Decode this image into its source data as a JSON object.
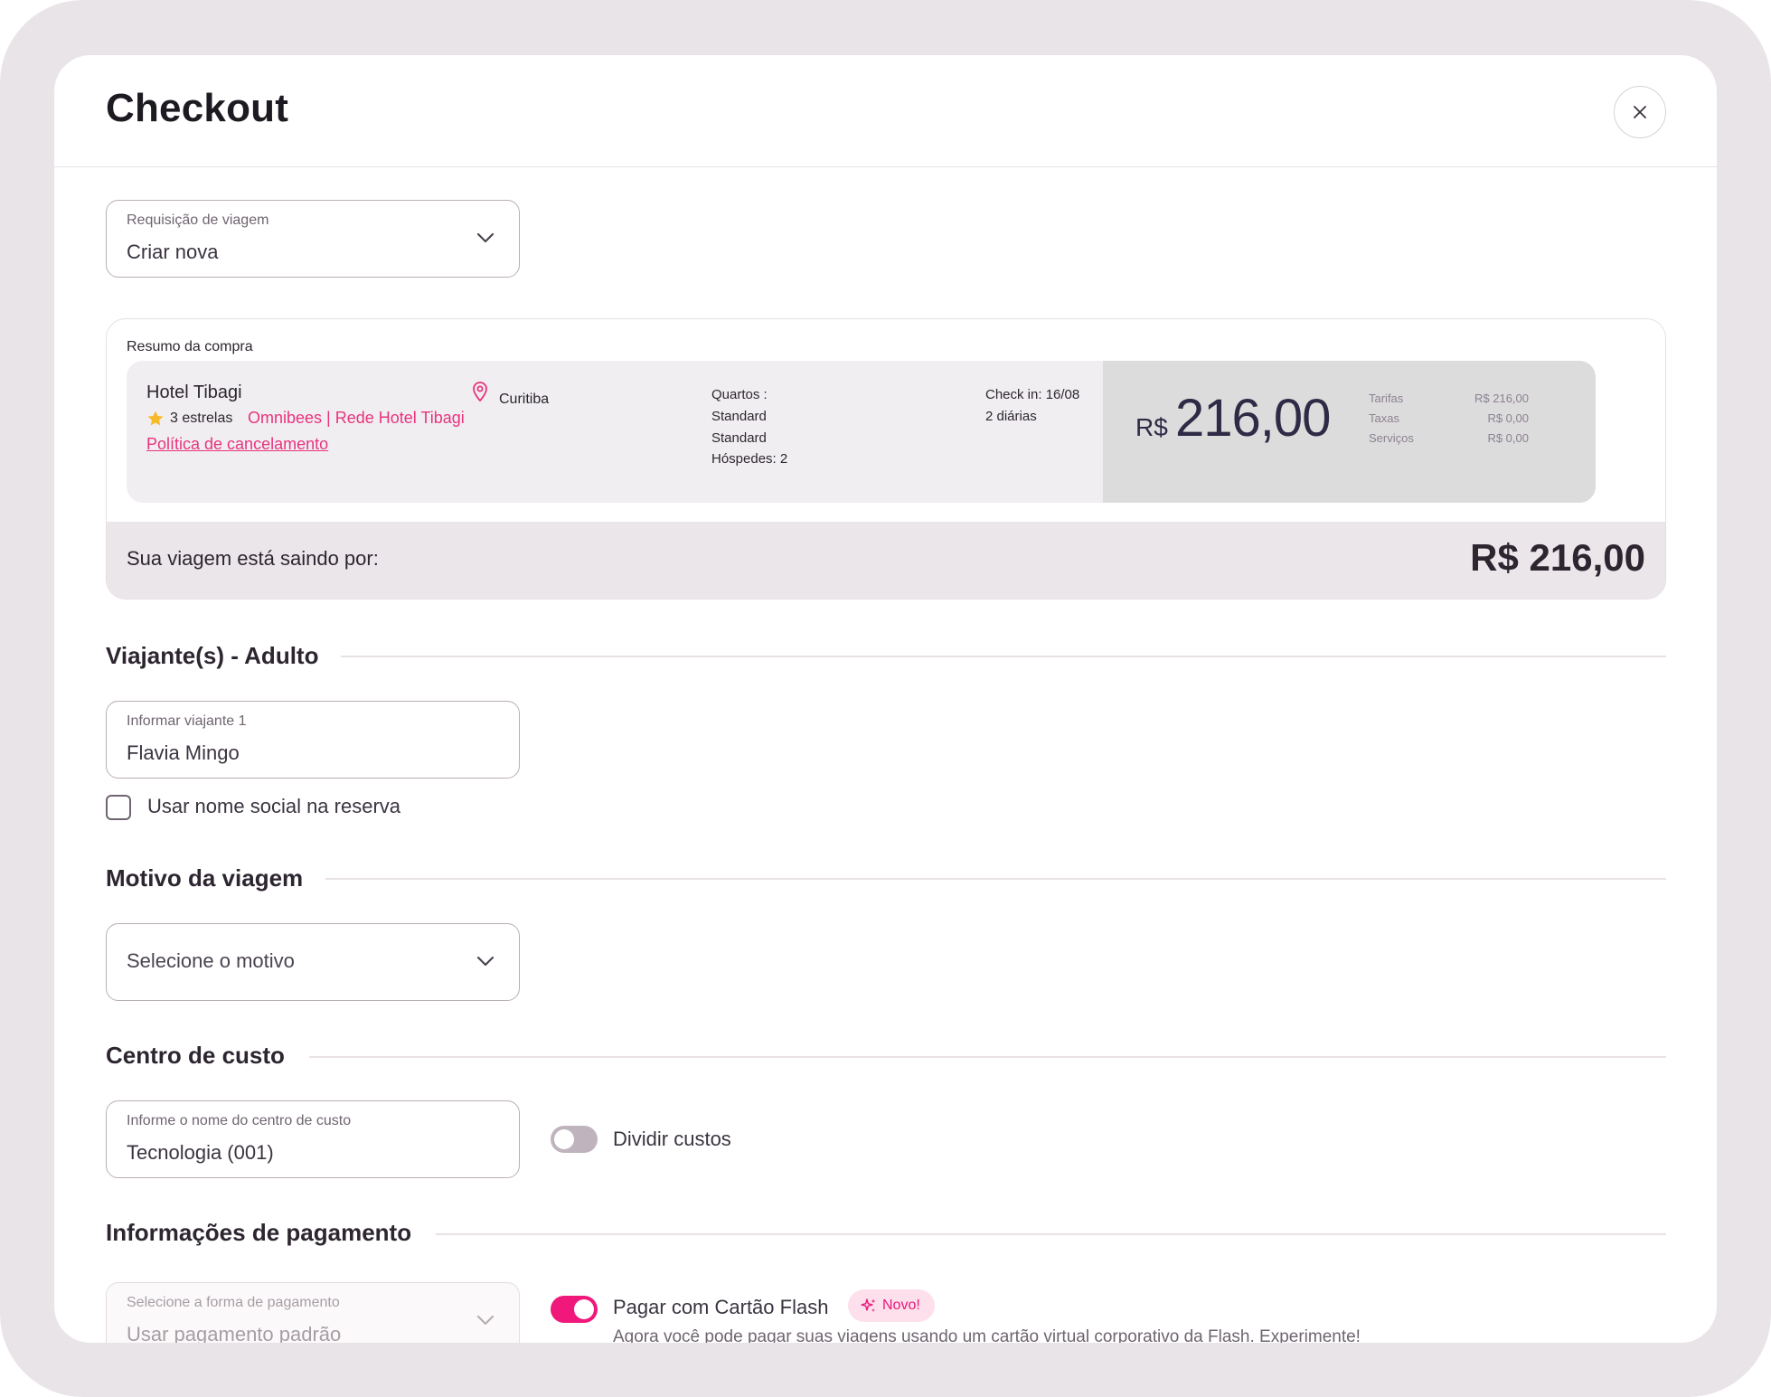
{
  "modal": {
    "title": "Checkout",
    "close_icon": "close-icon"
  },
  "trip_request": {
    "label": "Requisição de viagem",
    "value": "Criar nova"
  },
  "summary": {
    "title": "Resumo da compra",
    "hotel_name": "Hotel Tibagi",
    "stars": "3 estrelas",
    "provider": "Omnibees | Rede Hotel Tibagi",
    "policy_link": "Política de cancelamento",
    "city": "Curitiba",
    "rooms_label": "Quartos :",
    "room_1": "Standard",
    "room_2": "Standard",
    "guests": "Hóspedes: 2",
    "checkin": "Check in: 16/08",
    "nights": "2 diárias",
    "currency": "R$",
    "price": "216,00",
    "breakdown": [
      {
        "label": "Tarifas",
        "value": "R$ 216,00"
      },
      {
        "label": "Taxas",
        "value": "R$ 0,00"
      },
      {
        "label": "Serviços",
        "value": "R$ 0,00"
      }
    ],
    "total_label": "Sua viagem está saindo por:",
    "total_value": "R$ 216,00"
  },
  "travelers": {
    "section_title": "Viajante(s) - Adulto",
    "field_label": "Informar viajante 1",
    "field_value": "Flavia Mingo",
    "social_name_label": "Usar nome social na reserva"
  },
  "reason": {
    "section_title": "Motivo da viagem",
    "placeholder": "Selecione o motivo"
  },
  "cost_center": {
    "section_title": "Centro de custo",
    "field_label": "Informe o nome do centro de custo",
    "field_value": "Tecnologia (001)",
    "split_label": "Dividir custos"
  },
  "payment": {
    "section_title": "Informações de pagamento",
    "field_label": "Selecione a forma de pagamento",
    "field_value": "Usar pagamento padrão",
    "flash_label": "Pagar com Cartão Flash",
    "badge": "Novo!",
    "description": "Agora você pode pagar suas viagens usando um cartão virtual corporativo da Flash. Experimente!"
  },
  "colors": {
    "accent": "#e8347f",
    "toggle_on": "#f0187a",
    "frame": "#e9e4e8"
  }
}
